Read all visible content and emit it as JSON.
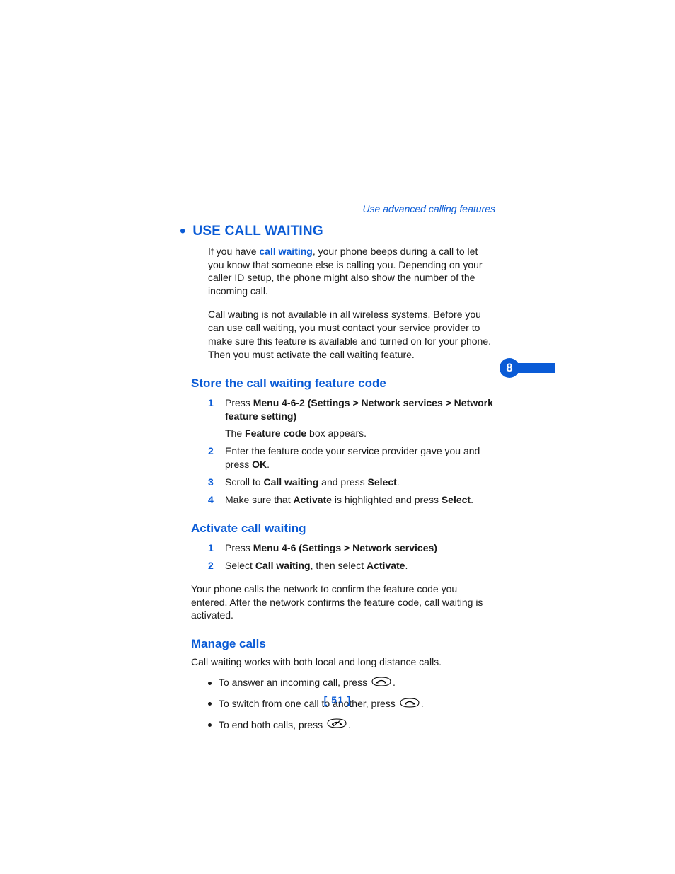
{
  "colors": {
    "accent": "#0a5bd6"
  },
  "running_head": "Use advanced calling features",
  "chapter_number": "8",
  "page_number": "[ 51 ]",
  "h1": "USE CALL WAITING",
  "intro": {
    "p1a": "If you have ",
    "p1_link": "call waiting",
    "p1b": ", your phone beeps during a call to let you know that someone else is calling you. Depending on your caller ID setup, the phone might also show the number of the incoming call.",
    "p2": "Call waiting is not available in all wireless systems. Before you can use call waiting, you must contact your service provider to make sure this feature is available and turned on for your phone. Then you must activate the call waiting feature."
  },
  "sections": {
    "store": {
      "title": "Store the call waiting feature code",
      "steps": [
        {
          "num": "1",
          "pre": "Press ",
          "b": "Menu 4-6-2 (Settings > Network services > Network feature setting)",
          "post": ""
        },
        {
          "num": "2",
          "pre": "Enter the feature code your service provider gave you and press ",
          "b": "OK",
          "post": "."
        },
        {
          "num": "3",
          "pre": "Scroll to ",
          "b": "Call waiting",
          "mid": " and press ",
          "b2": "Select",
          "post": "."
        },
        {
          "num": "4",
          "pre": "Make sure that ",
          "b": "Activate",
          "mid": " is highlighted and press ",
          "b2": "Select",
          "post": "."
        }
      ],
      "subtext_pre": "The ",
      "subtext_b": "Feature code",
      "subtext_post": " box appears."
    },
    "activate": {
      "title": "Activate call waiting",
      "steps": [
        {
          "num": "1",
          "pre": "Press ",
          "b": "Menu 4-6 (Settings > Network services)",
          "post": ""
        },
        {
          "num": "2",
          "pre": " Select ",
          "b": "Call waiting",
          "mid": ", then select ",
          "b2": "Activate",
          "post": "."
        }
      ],
      "result": "Your phone calls the network to confirm the feature code you entered. After the network confirms the feature code, call waiting is activated."
    },
    "manage": {
      "title": "Manage calls",
      "intro": "Call waiting works with both local and long distance calls.",
      "bullets": [
        {
          "pre": "To answer an incoming call, press ",
          "icon": "talk",
          "post": "."
        },
        {
          "pre": "To switch from one call to another, press ",
          "icon": "talk",
          "post": "."
        },
        {
          "pre": "To end both calls, press ",
          "icon": "end",
          "post": "."
        }
      ]
    }
  }
}
